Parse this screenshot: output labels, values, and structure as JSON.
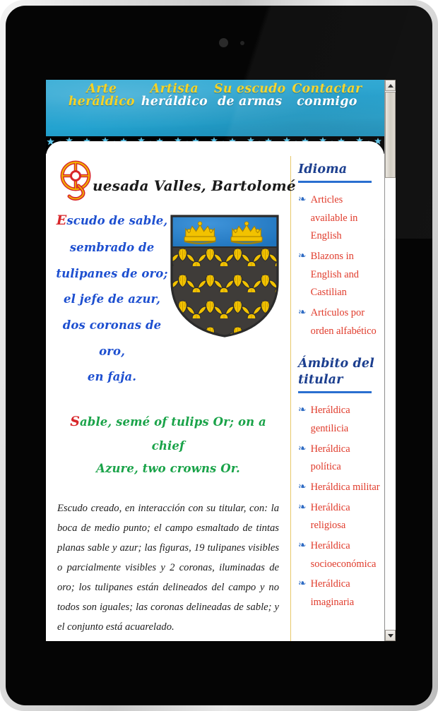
{
  "device": {
    "camera_name": "front-camera",
    "sensor_name": "ambient-light-sensor"
  },
  "nav": {
    "items": [
      {
        "line1": "Arte",
        "line2": "heráldico",
        "active": true
      },
      {
        "line1": "Artista",
        "line2": "heráldico",
        "active": false
      },
      {
        "line1": "Su escudo",
        "line2": "de armas",
        "active": false
      },
      {
        "line1": "Contactar",
        "line2": "conmigo",
        "active": false
      }
    ]
  },
  "main": {
    "title_initial": "Q",
    "title_rest": "uesada Valles, Bartolomé",
    "blazon_es": {
      "initial": "E",
      "lines": [
        "scudo de sable,",
        "sembrado de",
        "tulipanes de oro;",
        "el jefe de azur,",
        "dos coronas de oro,",
        "en faja."
      ]
    },
    "blazon_en": {
      "initial": "S",
      "lines": [
        "able, semé of tulips Or; on a chief",
        "Azure, two crowns Or."
      ]
    },
    "description": "Escudo creado, en interacción con su titular, con: la boca de medio punto; el campo esmaltado de tintas planas sable y azur; las figuras, 19 tulipanes visibles o parcialmente visibles y 2 coronas, iluminadas de oro; los tulipanes están delineados del campo y no todos son iguales; las coronas delineadas de sable; y el conjunto está acuarelado."
  },
  "shield": {
    "name": "coat-of-arms-shield",
    "field_tincture": "#3f3c39",
    "chief_tincture": "#2a7fc9",
    "charge_tincture": "#f2c200",
    "outline": "#2b2b2b",
    "tulips_visible": 19,
    "crowns": 2
  },
  "sidebar": {
    "sections": [
      {
        "heading": "Idioma",
        "items": [
          "Articles available in English",
          "Blazons in English and Castilian",
          "Artículos por orden alfabético"
        ]
      },
      {
        "heading": "Ámbito del titular",
        "items": [
          "Heráldica gentilicia",
          "Heráldica política",
          "Heráldica militar",
          "Heráldica religiosa",
          "Heráldica socioeconómica",
          "Heráldica imaginaria"
        ]
      }
    ],
    "bullet_glyph": "☙"
  },
  "colors": {
    "nav_background": "#23a3d0",
    "nav_active_text": "#f5d327",
    "nav_text": "#ffffff",
    "blazon_es_text": "#1d4fd0",
    "blazon_en_text": "#1aa349",
    "initial_red": "#d8262a",
    "sidebar_heading": "#1c3f8f",
    "sidebar_link": "#e03a2a",
    "sidebar_rule": "#2a6fd0",
    "gold_rule": "#e8c33f",
    "star_band_background": "#000000",
    "star_band_stars": "#5bc3e8"
  },
  "scrollbar": {
    "up_arrow_name": "scroll-up-arrow",
    "down_arrow_name": "scroll-down-arrow"
  }
}
